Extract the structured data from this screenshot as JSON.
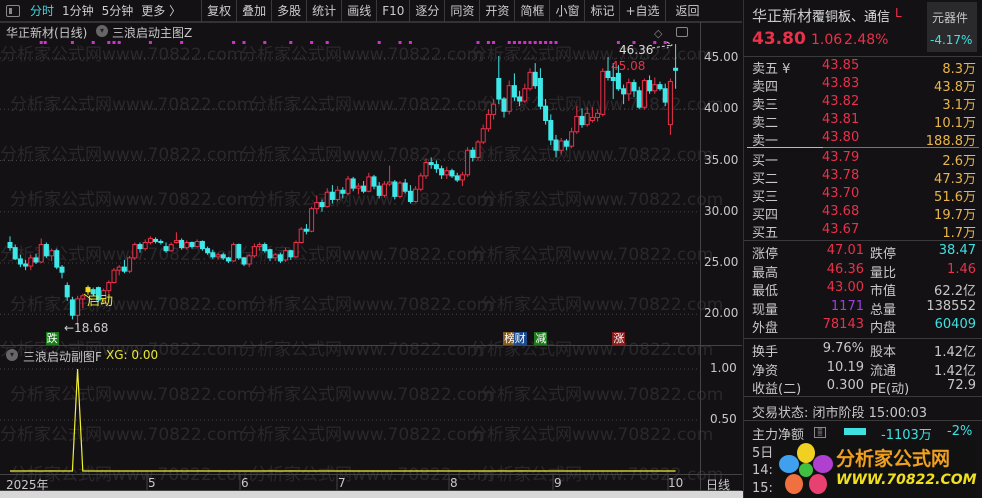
{
  "toolbar": {
    "tabs": [
      "分时",
      "1分钟",
      "5分钟",
      "更多 〉"
    ],
    "buttons": [
      "复权",
      "叠加",
      "多股",
      "统计",
      "画线",
      "F10",
      "逐分",
      "同资",
      "开资",
      "简框",
      "小窗",
      "标记",
      "+自选",
      "返回"
    ]
  },
  "watermark": "分析家公式网www.70822.com",
  "main_chart": {
    "title": "华正新材(日线)",
    "indicator": "三浪启动主图Z",
    "high_label": "46.36",
    "sub_high_label": "45.08",
    "low_label": "←18.68",
    "start_label": "启动",
    "badges": [
      {
        "text": "跌",
        "color": "#1c7a1c",
        "bar": 8
      },
      {
        "text": "榜",
        "color": "#8a5a1c",
        "bar": 96
      },
      {
        "text": "财",
        "color": "#1c4a8a",
        "bar": 98
      },
      {
        "text": "减",
        "color": "#1c7a1c",
        "bar": 102
      },
      {
        "text": "涨",
        "color": "#8a1c1c",
        "bar": 117
      }
    ]
  },
  "sub_chart": {
    "title": "三浪启动副图F",
    "xg_label": "XG: 0.00"
  },
  "axis": {
    "price_ticks": [
      "45.00",
      "40.00",
      "35.00",
      "30.00",
      "25.00",
      "20.00"
    ],
    "sub_ticks": [
      "1.00",
      "0.50"
    ],
    "dates": [
      "2025年",
      "5",
      "6",
      "7",
      "8",
      "9",
      "10"
    ],
    "period": "日线"
  },
  "chart_data": [
    {
      "type": "candlestick",
      "title": "华正新材(日线)",
      "ylim": [
        18,
        47
      ],
      "price_ticks": [
        45,
        40,
        35,
        30,
        25,
        20
      ],
      "ohlc": [
        [
          27.0,
          27.6,
          26.2,
          26.5
        ],
        [
          26.5,
          26.8,
          25.3,
          25.4
        ],
        [
          25.4,
          25.8,
          24.6,
          24.9
        ],
        [
          24.9,
          25.3,
          24.3,
          24.7
        ],
        [
          24.7,
          25.8,
          24.3,
          25.5
        ],
        [
          25.5,
          25.9,
          24.9,
          25.1
        ],
        [
          25.1,
          27.4,
          25.0,
          26.8
        ],
        [
          26.8,
          27.0,
          25.5,
          25.7
        ],
        [
          25.7,
          26.4,
          25.2,
          26.2
        ],
        [
          26.2,
          26.4,
          24.4,
          24.6
        ],
        [
          24.6,
          24.8,
          23.5,
          24.1
        ],
        [
          22.8,
          23.1,
          21.3,
          21.7
        ],
        [
          21.4,
          21.7,
          19.5,
          19.9
        ],
        [
          19.9,
          21.8,
          18.68,
          21.5
        ],
        [
          21.5,
          22.0,
          20.6,
          21.8
        ],
        [
          22.2,
          22.8,
          21.9,
          22.6
        ],
        [
          22.4,
          22.6,
          21.8,
          22.0
        ],
        [
          22.6,
          22.7,
          21.2,
          21.4
        ],
        [
          21.4,
          22.5,
          21.0,
          22.3
        ],
        [
          22.3,
          23.3,
          22.0,
          23.1
        ],
        [
          23.1,
          24.5,
          23.0,
          24.3
        ],
        [
          24.3,
          24.8,
          23.8,
          24.6
        ],
        [
          24.6,
          25.3,
          24.0,
          24.2
        ],
        [
          24.2,
          25.7,
          24.0,
          25.5
        ],
        [
          25.5,
          27.0,
          25.3,
          26.8
        ],
        [
          26.8,
          27.0,
          26.0,
          26.4
        ],
        [
          26.4,
          27.3,
          26.2,
          27.0
        ],
        [
          27.0,
          27.6,
          26.8,
          27.4
        ],
        [
          27.3,
          27.5,
          26.9,
          27.1
        ],
        [
          27.1,
          27.3,
          26.8,
          27.0
        ],
        [
          26.6,
          27.0,
          26.0,
          26.2
        ],
        [
          26.2,
          27.0,
          26.1,
          26.8
        ],
        [
          27.0,
          28.0,
          26.9,
          27.2
        ],
        [
          27.2,
          27.4,
          26.3,
          26.5
        ],
        [
          26.5,
          27.2,
          26.3,
          27.0
        ],
        [
          27.0,
          27.1,
          26.4,
          26.6
        ],
        [
          26.6,
          27.3,
          26.5,
          27.1
        ],
        [
          27.1,
          27.2,
          26.2,
          26.4
        ],
        [
          26.4,
          26.6,
          25.8,
          26.0
        ],
        [
          26.0,
          26.3,
          25.4,
          25.6
        ],
        [
          25.6,
          26.0,
          25.3,
          25.8
        ],
        [
          25.8,
          26.0,
          25.3,
          25.5
        ],
        [
          25.5,
          25.6,
          25.0,
          25.2
        ],
        [
          25.2,
          27.0,
          25.1,
          26.8
        ],
        [
          26.8,
          26.9,
          25.3,
          25.5
        ],
        [
          25.5,
          25.6,
          24.7,
          24.9
        ],
        [
          24.9,
          25.9,
          24.6,
          25.7
        ],
        [
          25.7,
          26.9,
          25.5,
          26.6
        ],
        [
          26.6,
          27.0,
          26.2,
          26.8
        ],
        [
          26.8,
          27.0,
          26.0,
          26.2
        ],
        [
          26.3,
          26.4,
          25.2,
          25.5
        ],
        [
          25.5,
          26.0,
          25.2,
          25.8
        ],
        [
          25.8,
          26.0,
          25.0,
          25.2
        ],
        [
          25.3,
          26.5,
          25.1,
          26.2
        ],
        [
          26.2,
          26.3,
          25.3,
          25.6
        ],
        [
          25.6,
          27.2,
          25.5,
          27.0
        ],
        [
          27.0,
          28.5,
          26.9,
          28.3
        ],
        [
          28.3,
          28.8,
          27.8,
          28.1
        ],
        [
          28.1,
          30.5,
          28.0,
          30.3
        ],
        [
          30.3,
          31.6,
          29.8,
          30.9
        ],
        [
          30.9,
          31.2,
          30.0,
          30.5
        ],
        [
          30.5,
          32.3,
          30.4,
          31.9
        ],
        [
          31.9,
          32.6,
          30.8,
          31.2
        ],
        [
          31.2,
          32.5,
          31.0,
          32.1
        ],
        [
          32.1,
          32.4,
          31.3,
          31.8
        ],
        [
          31.8,
          33.5,
          31.6,
          33.2
        ],
        [
          33.2,
          33.4,
          32.0,
          32.3
        ],
        [
          32.3,
          32.8,
          31.7,
          32.5
        ],
        [
          32.5,
          33.0,
          31.8,
          32.0
        ],
        [
          32.0,
          33.8,
          31.9,
          33.4
        ],
        [
          33.4,
          33.6,
          32.2,
          32.5
        ],
        [
          32.5,
          32.9,
          31.3,
          31.6
        ],
        [
          31.6,
          33.0,
          31.4,
          32.7
        ],
        [
          32.7,
          34.5,
          32.5,
          32.9
        ],
        [
          32.9,
          33.1,
          31.2,
          31.5
        ],
        [
          31.5,
          33.0,
          31.3,
          32.8
        ],
        [
          32.8,
          33.2,
          31.8,
          32.0
        ],
        [
          32.0,
          32.6,
          30.8,
          31.0
        ],
        [
          31.0,
          32.5,
          30.9,
          32.2
        ],
        [
          32.2,
          33.8,
          32.0,
          33.5
        ],
        [
          33.5,
          35.2,
          33.2,
          34.8
        ],
        [
          34.8,
          35.3,
          34.2,
          34.6
        ],
        [
          34.6,
          35.0,
          33.8,
          34.2
        ],
        [
          34.2,
          34.5,
          33.2,
          33.6
        ],
        [
          33.6,
          34.4,
          33.2,
          34.0
        ],
        [
          34.0,
          34.2,
          33.3,
          33.5
        ],
        [
          33.5,
          33.8,
          32.9,
          33.1
        ],
        [
          33.1,
          33.9,
          32.5,
          33.6
        ],
        [
          33.6,
          36.3,
          33.4,
          36.0
        ],
        [
          36.0,
          36.3,
          34.9,
          35.3
        ],
        [
          35.3,
          37.0,
          35.0,
          36.8
        ],
        [
          36.8,
          38.5,
          36.6,
          38.1
        ],
        [
          38.1,
          40.0,
          37.8,
          39.5
        ],
        [
          39.5,
          41.0,
          39.0,
          40.5
        ],
        [
          43.0,
          45.2,
          40.5,
          41.0
        ],
        [
          41.0,
          41.2,
          39.2,
          39.8
        ],
        [
          39.8,
          42.8,
          39.5,
          42.3
        ],
        [
          42.3,
          43.5,
          40.8,
          41.2
        ],
        [
          41.2,
          41.8,
          40.3,
          40.8
        ],
        [
          40.8,
          42.5,
          40.6,
          42.0
        ],
        [
          42.0,
          44.0,
          41.8,
          43.6
        ],
        [
          43.6,
          44.5,
          42.0,
          42.3
        ],
        [
          43.0,
          44.0,
          40.0,
          40.3
        ],
        [
          40.3,
          41.0,
          38.5,
          38.9
        ],
        [
          38.9,
          39.5,
          36.5,
          37.0
        ],
        [
          37.0,
          37.5,
          35.3,
          36.0
        ],
        [
          36.0,
          37.2,
          35.6,
          36.9
        ],
        [
          36.9,
          37.1,
          36.0,
          36.4
        ],
        [
          36.4,
          38.2,
          36.2,
          37.8
        ],
        [
          37.8,
          40.3,
          37.6,
          39.3
        ],
        [
          39.3,
          40.1,
          38.2,
          38.5
        ],
        [
          38.5,
          40.2,
          38.3,
          39.6
        ],
        [
          38.9,
          40.2,
          38.7,
          39.2
        ],
        [
          39.2,
          40.0,
          38.8,
          39.6
        ],
        [
          39.5,
          44.0,
          39.3,
          43.7
        ],
        [
          43.7,
          45.08,
          42.8,
          43.1
        ],
        [
          43.1,
          44.5,
          41.0,
          42.8
        ],
        [
          43.5,
          44.3,
          41.8,
          42.0
        ],
        [
          42.0,
          42.4,
          40.5,
          41.5
        ],
        [
          41.5,
          43.0,
          40.8,
          42.6
        ],
        [
          42.6,
          42.9,
          41.2,
          41.8
        ],
        [
          41.8,
          42.2,
          40.0,
          40.2
        ],
        [
          40.2,
          43.0,
          40.0,
          42.8
        ],
        [
          42.8,
          43.3,
          41.5,
          41.8
        ],
        [
          41.8,
          43.1,
          41.5,
          42.4
        ],
        [
          42.4,
          42.7,
          41.8,
          42.0
        ],
        [
          42.0,
          42.5,
          40.3,
          40.7
        ],
        [
          38.5,
          43.0,
          37.5,
          42.7
        ],
        [
          44.0,
          46.36,
          42.0,
          43.8
        ]
      ],
      "signal_bars": [
        6,
        6,
        12,
        16,
        19,
        20,
        21,
        27,
        33,
        43,
        45,
        49,
        54,
        58,
        61,
        71,
        75,
        77,
        90,
        92,
        93,
        96,
        97,
        98,
        99,
        100,
        101,
        102,
        103,
        104,
        105,
        117,
        120,
        124,
        126
      ],
      "start_bar": 15
    },
    {
      "type": "line",
      "title": "三浪启动副图F",
      "series": [
        {
          "name": "XG",
          "spike_bar": 13,
          "spike_value": 1.0
        }
      ],
      "ylim": [
        0,
        1.1
      ],
      "sub_ticks": [
        1.0,
        0.5
      ]
    }
  ],
  "quote": {
    "name": "华正新材",
    "sector": "覆铜板、通信",
    "flag": "L",
    "industry": "元器件",
    "industry_change": "-4.17%",
    "price": "43.80",
    "change": "1.06",
    "change_pct": "2.48%"
  },
  "order_book": {
    "sell": [
      {
        "label": "卖五 ¥",
        "price": "43.85",
        "vol": "8.3万"
      },
      {
        "label": "卖四",
        "price": "43.83",
        "vol": "43.8万"
      },
      {
        "label": "卖三",
        "price": "43.82",
        "vol": "3.1万"
      },
      {
        "label": "卖二",
        "price": "43.81",
        "vol": "10.1万"
      },
      {
        "label": "卖一",
        "price": "43.80",
        "vol": "188.8万"
      }
    ],
    "buy": [
      {
        "label": "买一",
        "price": "43.79",
        "vol": "2.6万"
      },
      {
        "label": "买二",
        "price": "43.78",
        "vol": "47.3万"
      },
      {
        "label": "买三",
        "price": "43.70",
        "vol": "51.6万"
      },
      {
        "label": "买四",
        "price": "43.68",
        "vol": "19.7万"
      },
      {
        "label": "买五",
        "price": "43.67",
        "vol": "1.7万"
      }
    ]
  },
  "stats": [
    {
      "l": "涨停",
      "v": "47.01",
      "vc": "red",
      "l2": "跌停",
      "v2": "38.47",
      "v2c": "cyan"
    },
    {
      "l": "最高",
      "v": "46.36",
      "vc": "red",
      "l2": "量比",
      "v2": "1.46",
      "v2c": "red"
    },
    {
      "l": "最低",
      "v": "43.00",
      "vc": "red",
      "l2": "市值",
      "v2": "62.2亿",
      "v2c": "grey"
    },
    {
      "l": "现量",
      "v": "1171",
      "vc": "purple",
      "l2": "总量",
      "v2": "138552",
      "v2c": "grey"
    },
    {
      "l": "外盘",
      "v": "78143",
      "vc": "red",
      "l2": "内盘",
      "v2": "60409",
      "v2c": "cyan"
    }
  ],
  "stats2": [
    {
      "l": "换手",
      "v": "9.76%",
      "l2": "股本",
      "v2": "1.42亿"
    },
    {
      "l": "净资",
      "v": "10.19",
      "l2": "流通",
      "v2": "1.42亿"
    },
    {
      "l": "收益(二)",
      "v": "0.300",
      "l2": "PE(动)",
      "v2": "72.9"
    }
  ],
  "status": "交易状态: 闭市阶段 15:00:03",
  "flow": {
    "label": "主力净额",
    "value": "-1103万",
    "pct": "-2%",
    "row2": "5日",
    "row3": "14:",
    "row4": "15:"
  },
  "logo": {
    "text": "分析家公式网",
    "url": "WWW.70822.COM"
  }
}
